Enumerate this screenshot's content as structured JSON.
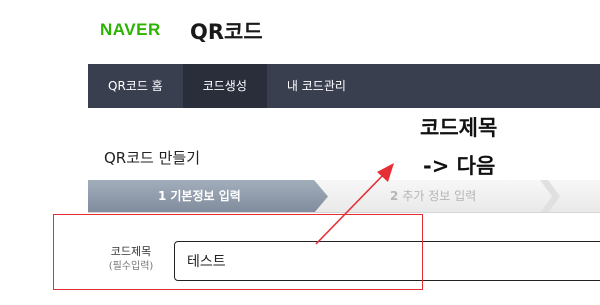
{
  "header": {
    "logo_text": "NAVER",
    "service_title": "QR코드"
  },
  "nav": {
    "items": [
      {
        "label": "QR코드 홈",
        "active": false
      },
      {
        "label": "코드생성",
        "active": true
      },
      {
        "label": "내 코드관리",
        "active": false
      }
    ]
  },
  "page": {
    "heading": "QR코드 만들기"
  },
  "steps": [
    {
      "number": "1",
      "label": "기본정보 입력",
      "active": true
    },
    {
      "number": "2",
      "label": "추가 정보 입력",
      "active": false
    }
  ],
  "form": {
    "code_title_label": "코드제목",
    "code_title_sublabel": "(필수입력)",
    "code_title_value": "테스트"
  },
  "annotation": {
    "line1": "코드제목",
    "line2": "-> 다음",
    "color": "#e62f34"
  }
}
